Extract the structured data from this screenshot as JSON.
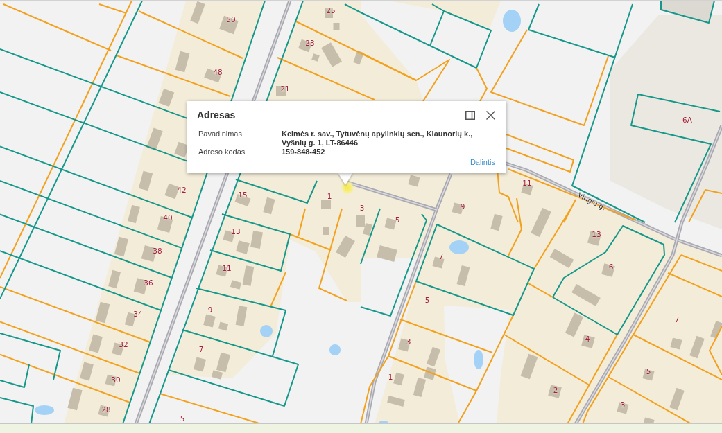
{
  "map": {
    "house_numbers": [
      "25",
      "50",
      "23",
      "48",
      "21",
      "6A",
      "11",
      "42",
      "15",
      "1",
      "9",
      "3",
      "40",
      "5",
      "13",
      "13",
      "38",
      "7",
      "6",
      "11",
      "36",
      "5",
      "9",
      "34",
      "7",
      "4",
      "3",
      "32",
      "7",
      "5",
      "1",
      "30",
      "2",
      "3",
      "28",
      "5"
    ],
    "street_labels": [
      "Vingio g."
    ]
  },
  "popup": {
    "title": "Adresas",
    "fields": [
      {
        "label": "Pavadinimas",
        "value": "Kelmės r. sav., Tytuvėnų apylinkių sen., Kiaunorių k., Vyšnių g. 1, LT-86446"
      },
      {
        "label": "Adreso kodas",
        "value": "159-848-452"
      }
    ],
    "link": "Dalintis"
  }
}
